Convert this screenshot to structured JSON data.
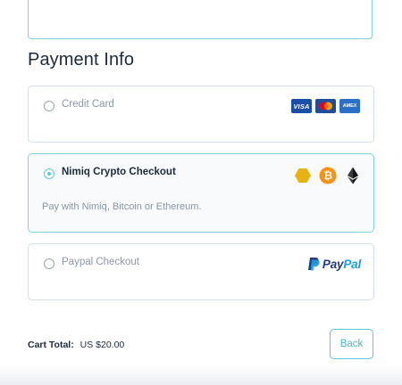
{
  "payment": {
    "title": "Payment Info",
    "options": [
      {
        "label": "Credit Card",
        "selected": false,
        "logos": [
          {
            "name": "visa",
            "text": "VISA",
            "color": "#1a4fa8"
          },
          {
            "name": "mastercard",
            "colors": [
              "#eb001b",
              "#f79e1b"
            ]
          },
          {
            "name": "amex",
            "text": "AMEX",
            "color": "#2b6fc9"
          }
        ]
      },
      {
        "label": "Nimiq Crypto Checkout",
        "selected": true,
        "description": "Pay with Nimiq, Bitcoin or Ethereum.",
        "logos": [
          {
            "name": "nimiq-icon",
            "color": "#e9b213"
          },
          {
            "name": "bitcoin-icon",
            "color": "#f7931a"
          },
          {
            "name": "ethereum-icon",
            "color": "#222222"
          }
        ]
      },
      {
        "label": "Paypal Checkout",
        "selected": false,
        "logo": {
          "pay": "Pay",
          "pal": "Pal",
          "colors": [
            "#253b80",
            "#1c9fe0"
          ]
        }
      }
    ]
  },
  "cart": {
    "label": "Cart Total:",
    "value": "US $20.00"
  },
  "actions": {
    "back_label": "Back"
  },
  "colors": {
    "accent": "#5ccad9",
    "border": "#d7dde5",
    "text": "#1c2a3a",
    "muted": "#8c98a6"
  }
}
